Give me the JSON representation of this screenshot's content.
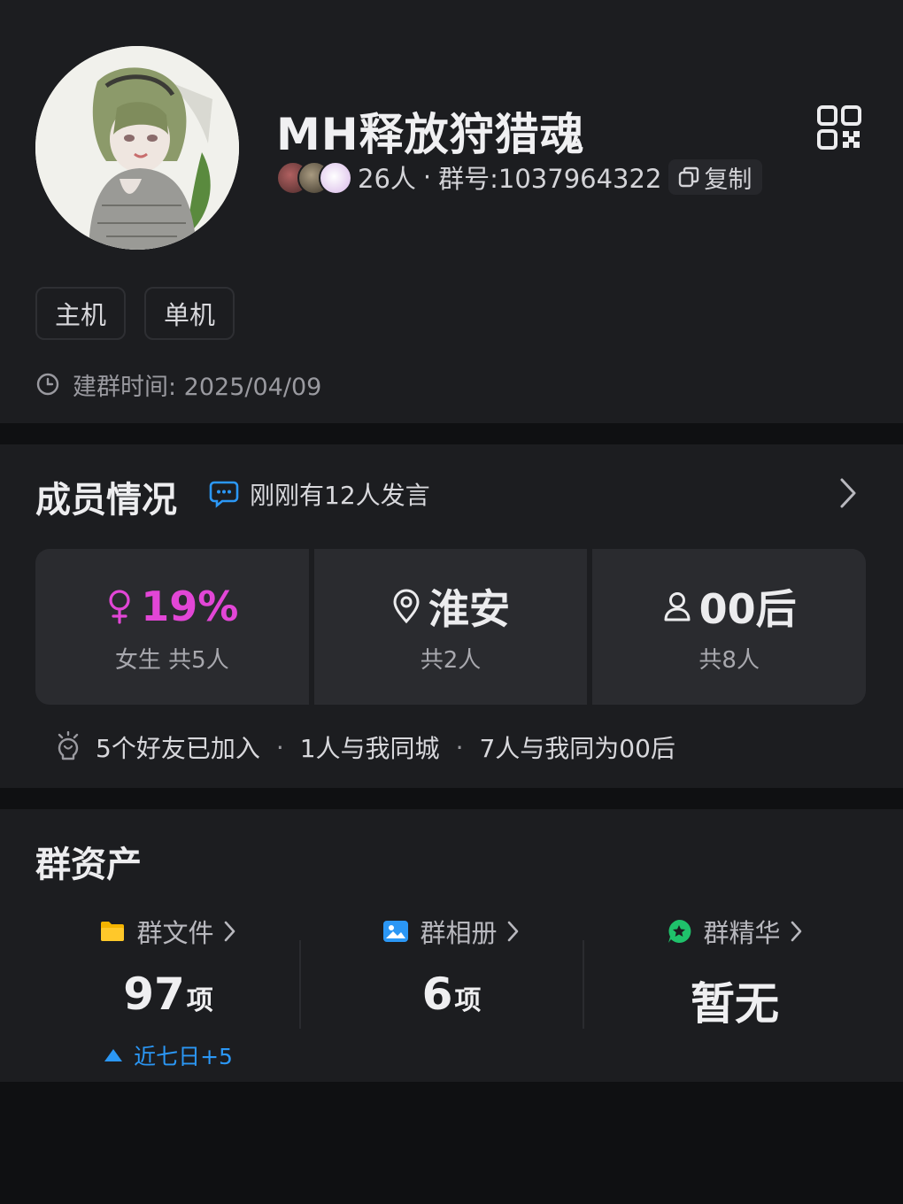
{
  "header": {
    "group_name": "MH释放狩猎魂",
    "member_count": "26人",
    "separator": "·",
    "group_number": "群号:1037964322",
    "copy_label": "复制",
    "tags": [
      "主机",
      "单机"
    ],
    "created_label": "建群时间: 2025/04/09"
  },
  "members": {
    "title": "成员情况",
    "active_note": "刚刚有12人发言",
    "stats": [
      {
        "value": "19%",
        "sub": "女生 共5人",
        "icon": "female-icon"
      },
      {
        "value": "淮安",
        "sub": "共2人",
        "icon": "location-icon"
      },
      {
        "value": "00后",
        "sub": "共8人",
        "icon": "person-icon"
      }
    ],
    "friends_joined": "5个好友已加入",
    "same_city": "1人与我同城",
    "same_age": "7人与我同为00后",
    "dot": "·"
  },
  "assets": {
    "title": "群资产",
    "items": [
      {
        "label": "群文件",
        "value": "97",
        "unit": "项",
        "trend": "近七日+5",
        "icon": "folder-icon"
      },
      {
        "label": "群相册",
        "value": "6",
        "unit": "项",
        "icon": "album-icon"
      },
      {
        "label": "群精华",
        "value": "暂无",
        "unit": "",
        "icon": "essence-icon"
      }
    ]
  },
  "colors": {
    "accent_blue": "#2b97f5",
    "female_pink": "#e246d6",
    "folder_yellow": "#f5b400",
    "essence_green": "#1fc26b"
  }
}
